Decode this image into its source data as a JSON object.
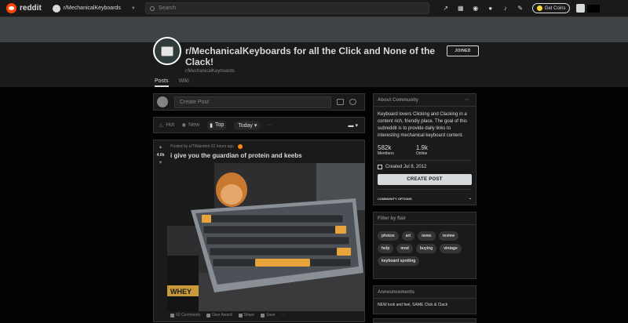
{
  "topbar": {
    "logo_text": "reddit",
    "subreddit_select": "r/MechanicalKeyboards",
    "search_placeholder": "Search",
    "coins_label": "Get Coins"
  },
  "community": {
    "title": "r/MechanicalKeyboards for all the Click and None of the Clack!",
    "name": "r/MechanicalKeyboards",
    "joined_label": "JOINED",
    "tabs": [
      "Posts",
      "Wiki"
    ]
  },
  "create_post": {
    "placeholder": "Create Post"
  },
  "sort": {
    "hot": "Hot",
    "new": "New",
    "top": "Top",
    "time": "Today",
    "more": "···"
  },
  "post": {
    "score": "4.0k",
    "posted_by": "Posted by u/TWaimbot 22 hours ago",
    "title": "i give you the guardian of protein and keebs",
    "comments": "92 Comments",
    "give_award": "Give Award",
    "share": "Share",
    "save": "Save",
    "more": "···",
    "image_text": "WHEY"
  },
  "about": {
    "heading": "About Community",
    "dots": "···",
    "description": "Keyboard lovers Clicking and Clacking in a content rich, friendly place. The goal of this subreddit is to provide daily links to interesting mechanical keyboard content.",
    "members_count": "582k",
    "members_label": "Members",
    "online_count": "1.9k",
    "online_label": "Online",
    "created": "Created Jul 8, 2012",
    "create_post_button": "CREATE POST",
    "community_options": "COMMUNITY OPTIONS"
  },
  "flair": {
    "heading": "Filter by flair",
    "items": [
      "photos",
      "art",
      "news",
      "review",
      "help",
      "mod",
      "buying",
      "vintage",
      "keyboard spotting"
    ]
  },
  "announcements": {
    "heading": "Announcements",
    "text": "NEW look and feel, SAME Click & Clack"
  }
}
